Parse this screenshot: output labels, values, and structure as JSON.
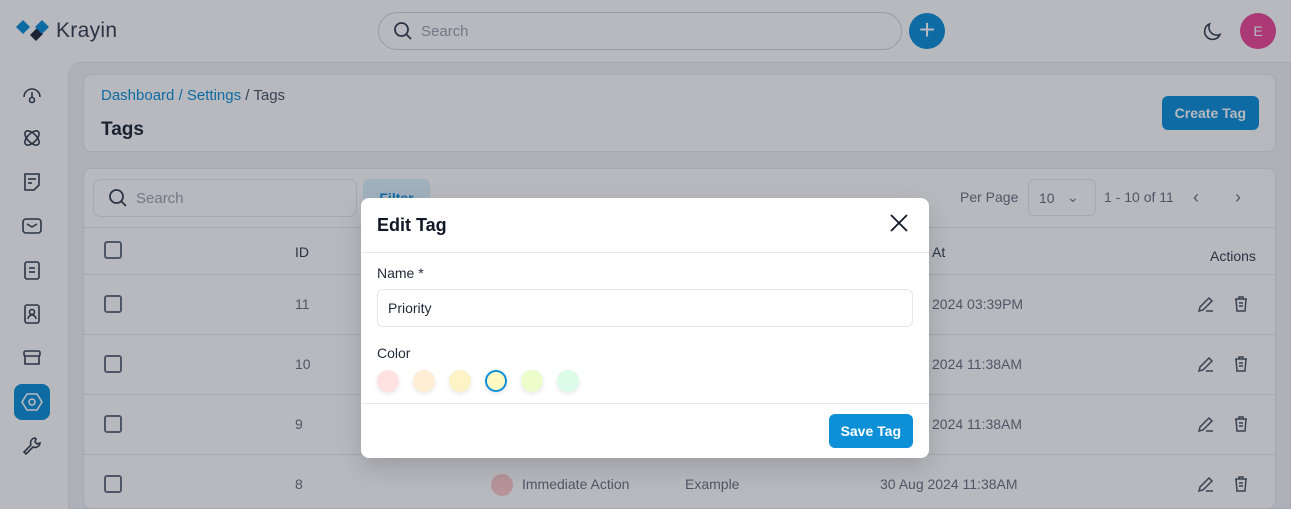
{
  "app": {
    "name": "Krayin",
    "avatar_initial": "E",
    "search_placeholder": "Search"
  },
  "sidebar": {
    "items": [
      "dashboard",
      "leads",
      "quotes",
      "mail",
      "activities",
      "contacts",
      "products",
      "settings",
      "configuration"
    ],
    "active": "settings"
  },
  "header": {
    "breadcrumb": {
      "dashboard": "Dashboard",
      "settings": "Settings",
      "current": "Tags",
      "sep": "/"
    },
    "title": "Tags",
    "create_label": "Create Tag"
  },
  "table": {
    "search_placeholder": "Search",
    "filter_label": "Filter",
    "per_page_label": "Per Page",
    "per_page_value": "10",
    "range": "1 - 10 of 11",
    "columns": {
      "id": "ID",
      "created_at_partial": "At",
      "actions": "Actions"
    },
    "rows": [
      {
        "id": "11",
        "created_at_visible": "2024 03:39PM"
      },
      {
        "id": "10",
        "created_at_visible": "2024 11:38AM"
      },
      {
        "id": "9",
        "created_at_visible": "2024 11:38AM"
      },
      {
        "id": "8",
        "name": "Immediate Action",
        "user": "Example",
        "created_at_visible": "30 Aug 2024 11:38AM",
        "color": "#fecaca"
      }
    ]
  },
  "modal": {
    "title": "Edit Tag",
    "name_label": "Name *",
    "name_value": "Priority",
    "color_label": "Color",
    "save_label": "Save Tag",
    "colors": [
      "#fee2e2",
      "#ffedd5",
      "#fef3c7",
      "#fef9c3",
      "#ecfccb",
      "#dcfce7"
    ],
    "selected_color_index": 3
  },
  "accent": "#0e90d9"
}
